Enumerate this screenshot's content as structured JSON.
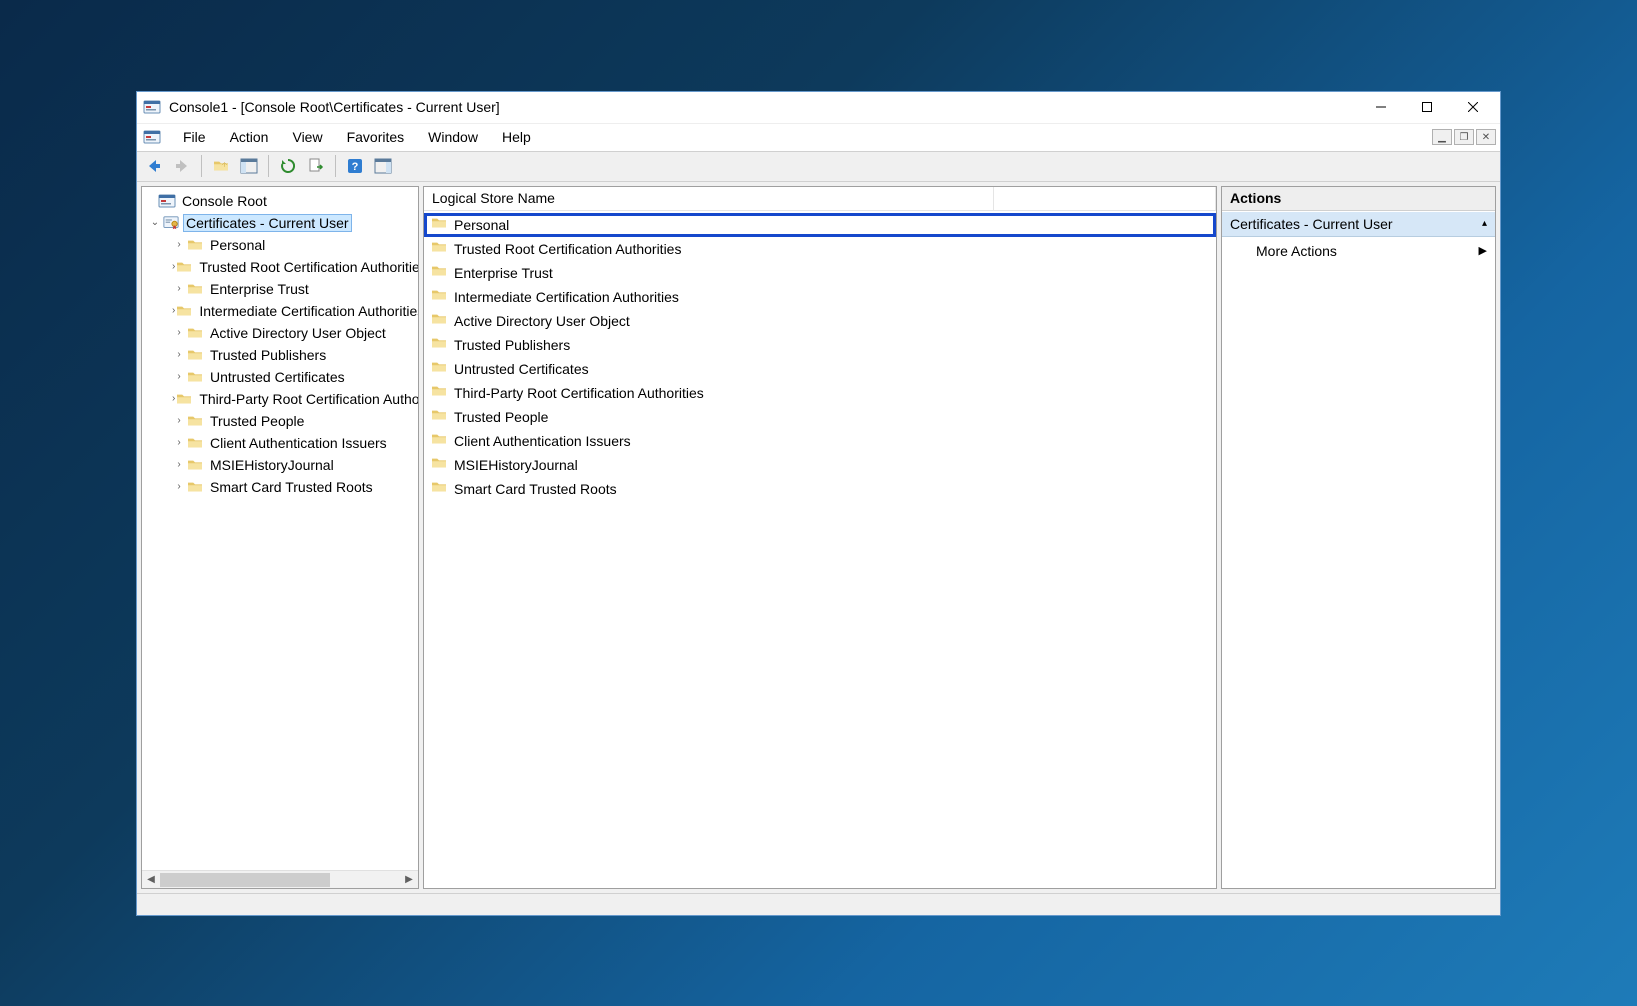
{
  "title": "Console1 - [Console Root\\Certificates - Current User]",
  "menubar": [
    "File",
    "Action",
    "View",
    "Favorites",
    "Window",
    "Help"
  ],
  "tree": {
    "root": "Console Root",
    "selected": "Certificates - Current User",
    "children": [
      "Personal",
      "Trusted Root Certification Authorities",
      "Enterprise Trust",
      "Intermediate Certification Authorities",
      "Active Directory User Object",
      "Trusted Publishers",
      "Untrusted Certificates",
      "Third-Party Root Certification Authorities",
      "Trusted People",
      "Client Authentication Issuers",
      "MSIEHistoryJournal",
      "Smart Card Trusted Roots"
    ]
  },
  "list": {
    "header": "Logical Store Name",
    "highlighted_index": 0,
    "items": [
      "Personal",
      "Trusted Root Certification Authorities",
      "Enterprise Trust",
      "Intermediate Certification Authorities",
      "Active Directory User Object",
      "Trusted Publishers",
      "Untrusted Certificates",
      "Third-Party Root Certification Authorities",
      "Trusted People",
      "Client Authentication Issuers",
      "MSIEHistoryJournal",
      "Smart Card Trusted Roots"
    ]
  },
  "actions": {
    "title": "Actions",
    "section": "Certificates - Current User",
    "links": [
      "More Actions"
    ]
  }
}
